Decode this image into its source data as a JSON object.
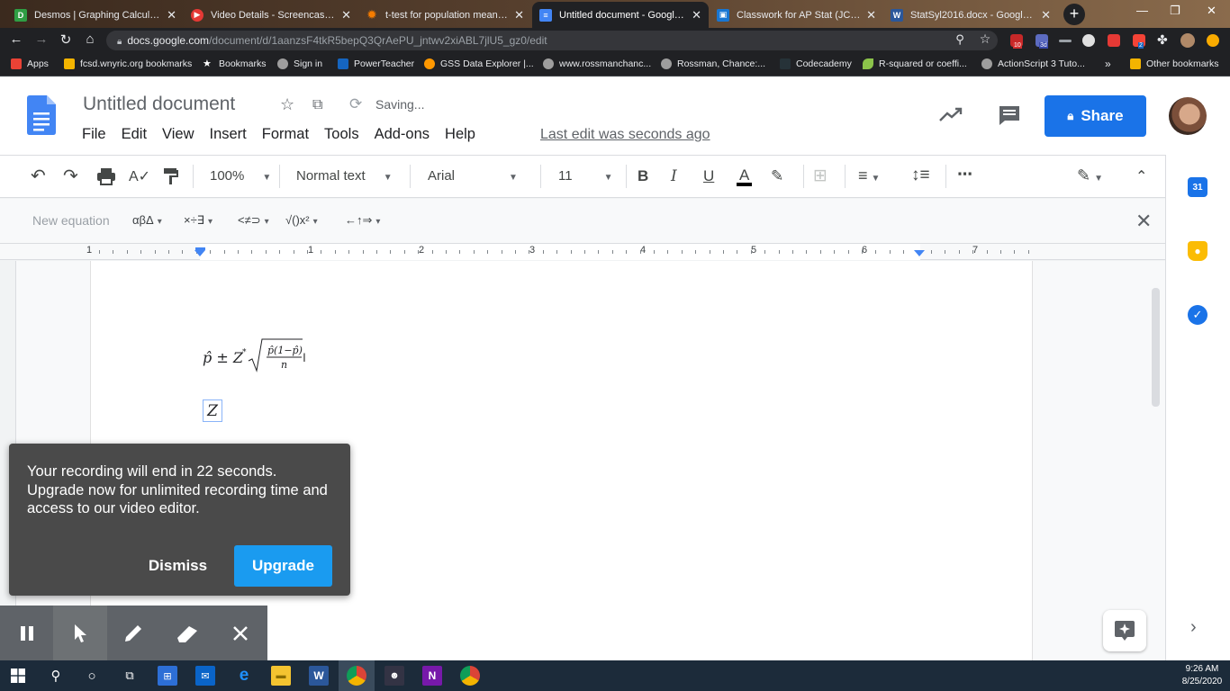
{
  "browser": {
    "tabs": [
      {
        "label": "Desmos | Graphing Calculator",
        "fav_color": "#2f9e44",
        "fav_glyph": "D"
      },
      {
        "label": "Video Details - Screencastify",
        "fav_color": "#e53935",
        "fav_glyph": "▶"
      },
      {
        "label": "t-test for population mean - W",
        "fav_color": "#f57c00",
        "fav_glyph": "✹"
      },
      {
        "label": "Untitled document - Google D",
        "fav_color": "#4285f4",
        "fav_glyph": "≡"
      },
      {
        "label": "Classwork for AP Stat (JCC) F20",
        "fav_color": "#1976d2",
        "fav_glyph": "▣"
      },
      {
        "label": "StatSyl2016.docx - Google Dri",
        "fav_color": "#2b579a",
        "fav_glyph": "W"
      }
    ],
    "new_tab": "+",
    "window_controls": [
      "—",
      "❐",
      "✕"
    ],
    "url_domain": "docs.google.com",
    "url_path": "/document/d/1aanzsF4tkR5bepQ3QrAePU_jntwv2xiABL7jlU5_gz0/edit",
    "ext_badges": [
      "10",
      "3d",
      "2"
    ],
    "bookmarks": [
      {
        "label": "Apps",
        "color": "#e94235"
      },
      {
        "label": "fcsd.wnyric.org bookmarks",
        "color": "#f4b400"
      },
      {
        "label": "Bookmarks",
        "color": "#ffffff"
      },
      {
        "label": "Sign in",
        "color": "#9e9e9e"
      },
      {
        "label": "PowerTeacher",
        "color": "#1565c0"
      },
      {
        "label": "GSS Data Explorer |...",
        "color": "#ff9800"
      },
      {
        "label": "www.rossmanchanc...",
        "color": "#9e9e9e"
      },
      {
        "label": "Rossman, Chance:...",
        "color": "#9e9e9e"
      },
      {
        "label": "Codecademy",
        "color": "#263238"
      },
      {
        "label": "R-squared or coeffi...",
        "color": "#8bc34a"
      },
      {
        "label": "ActionScript 3 Tuto...",
        "color": "#9e9e9e"
      }
    ],
    "bookmarks_more": "»",
    "other_bookmarks": "Other bookmarks"
  },
  "docs": {
    "title": "Untitled document",
    "saving": "Saving...",
    "menu": [
      "File",
      "Edit",
      "View",
      "Insert",
      "Format",
      "Tools",
      "Add-ons",
      "Help"
    ],
    "last_edit": "Last edit was seconds ago",
    "share": "Share",
    "toolbar": {
      "zoom": "100%",
      "style": "Normal text",
      "font": "Arial",
      "size": "11",
      "bold": "B",
      "italic": "I",
      "underline": "U",
      "text_color": "A"
    },
    "equation_bar": {
      "new_equation": "New equation",
      "greek": "αβΔ",
      "operators": "×÷∃",
      "relations": "<≠⊃",
      "math": "√()x²",
      "arrows": "←↑⇒"
    },
    "ruler_numbers": [
      "1",
      "1",
      "2",
      "3",
      "4",
      "5",
      "6",
      "7"
    ],
    "equation": {
      "lhs": "p̂ ± Z",
      "sup": "*",
      "frac_num": "p̂(1−p̂)",
      "frac_den": "n"
    },
    "current_symbol": "Z"
  },
  "side_panel": {
    "calendar_day": "31",
    "accent_calendar": "#1a73e8",
    "accent_keep": "#fbbc04",
    "accent_tasks": "#1a73e8"
  },
  "popup": {
    "message": "Your recording will end in 22 seconds. Upgrade now for unlimited recording time and access to our video editor.",
    "dismiss": "Dismiss",
    "upgrade": "Upgrade"
  },
  "taskbar": {
    "time": "9:26 AM",
    "date": "8/25/2020"
  }
}
